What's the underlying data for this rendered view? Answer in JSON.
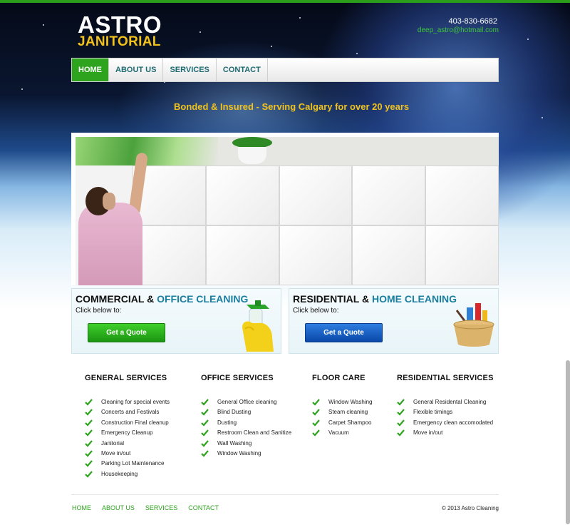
{
  "brand": {
    "line1": "ASTRO",
    "line2": "JANITORIAL"
  },
  "contact": {
    "phone": "403-830-6682",
    "email": "deep_astro@hotmail.com"
  },
  "nav": [
    {
      "label": "HOME",
      "active": true
    },
    {
      "label": "ABOUT US",
      "active": false
    },
    {
      "label": "SERVICES",
      "active": false
    },
    {
      "label": "CONTACT",
      "active": false
    }
  ],
  "tagline": "Bonded & Insured - Serving Calgary for over 20 years",
  "cards": {
    "commercial": {
      "title_a": "COMMERCIAL & ",
      "title_b": "OFFICE CLEANING",
      "sub": "Click below to:",
      "button": "Get a Quote"
    },
    "residential": {
      "title_a": "RESIDENTIAL & ",
      "title_b": "HOME CLEANING",
      "sub": "Click below to:",
      "button": "Get a Quote"
    }
  },
  "services": [
    {
      "title": "GENERAL SERVICES",
      "items": [
        "Cleaning for special events",
        "Concerts and Festivals",
        "Construction Final cleanup",
        "Emergency Cleanup",
        "Janitorial",
        "Move in/out",
        "Parking Lot Maintenance",
        "Housekeeping"
      ]
    },
    {
      "title": "OFFICE SERVICES",
      "items": [
        "General Office cleaning",
        "Blind Dusting",
        "Dusting",
        "Restroom Clean and Sanitize",
        "Wall Washing",
        "Window Washing"
      ]
    },
    {
      "title": "FLOOR CARE",
      "items": [
        "Window Washing",
        "Steam cleaning",
        "Carpet Shampoo",
        "Vacuum"
      ]
    },
    {
      "title": "RESIDENTIAL SERVICES",
      "items": [
        "General Residental Cleaning",
        "Flexible timings",
        "Emergency clean accomodated",
        "Move in/out"
      ]
    }
  ],
  "footer": {
    "links": [
      "HOME",
      "ABOUT US",
      "SERVICES",
      "CONTACT"
    ],
    "copyright": "© 2013 Astro Cleaning"
  },
  "colors": {
    "accent_green": "#2ea31e",
    "gold": "#f2c21c",
    "teal": "#1a7ea0",
    "quote_blue": "#0a48a8"
  },
  "icons": [
    "check-icon",
    "spray-glove-icon",
    "cleaning-bucket-icon"
  ]
}
